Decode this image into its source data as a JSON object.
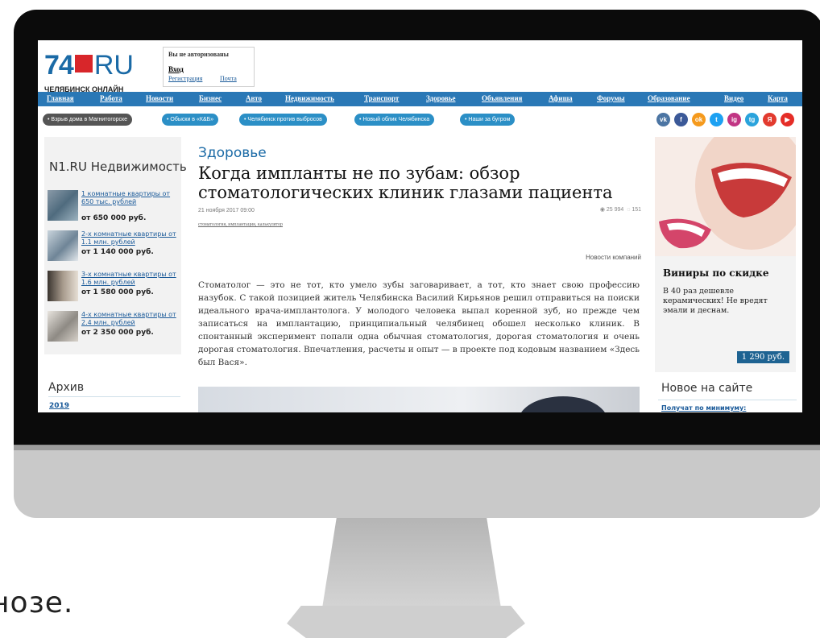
{
  "overlay": {
    "caption": "нозе."
  },
  "header": {
    "logo_number": "74",
    "logo_ru": "RU",
    "logo_sub": "ЧЕЛЯБИНСК ОНЛАЙН",
    "auth": {
      "title": "Вы не авторизованы",
      "login": "Вход",
      "register": "Регистрация",
      "mail": "Почта"
    }
  },
  "nav": [
    "Главная",
    "Работа",
    "Новости",
    "Бизнес",
    "Авто",
    "Недвижимость",
    "Транспорт",
    "Здоровье",
    "Объявления",
    "Афиша",
    "Форумы",
    "Образование",
    "Видео",
    "Карта"
  ],
  "tags": [
    "Взрыв дома в Магнитогорске",
    "Обыски в «К&Б»",
    "Челябинск против выбросов",
    "Новый облик Челябинска",
    "Наши за бугром"
  ],
  "social": [
    {
      "icon": "vk-icon",
      "label": "vk",
      "color": "#4c75a3"
    },
    {
      "icon": "facebook-icon",
      "label": "f",
      "color": "#3b5998"
    },
    {
      "icon": "odnoklassniki-icon",
      "label": "ok",
      "color": "#f59a1d"
    },
    {
      "icon": "twitter-icon",
      "label": "t",
      "color": "#1da1f2"
    },
    {
      "icon": "instagram-icon",
      "label": "ig",
      "color": "#c13584"
    },
    {
      "icon": "telegram-icon",
      "label": "tg",
      "color": "#2aa3dc"
    },
    {
      "icon": "yandex-icon",
      "label": "Я",
      "color": "#e23b2f"
    },
    {
      "icon": "youtube-icon",
      "label": "▶",
      "color": "#e52d27"
    }
  ],
  "left": {
    "n1_title": "N1.RU Недвижимость",
    "items": [
      {
        "link": "1 комнатные квартиры от 650 тыс. рублей",
        "price": "от 650 000 руб."
      },
      {
        "link": "2-х комнатные квартиры от 1.1 млн. рублей",
        "price": "от 1 140 000 руб."
      },
      {
        "link": "3-х комнатные квартиры от 1.6 млн. рублей",
        "price": "от 1 580 000 руб."
      },
      {
        "link": "4-х комнатные квартиры от 2.4 млн. рублей",
        "price": "от 2 350 000 руб."
      }
    ],
    "archive_title": "Архив",
    "archive_year": "2019"
  },
  "article": {
    "section": "Здоровье",
    "headline": "Когда импланты не по зубам: обзор стоматологических клиник глазами пациента",
    "date": "21 ноября 2017 09:00",
    "views": "25 994",
    "comments": "151",
    "tags": "стоматология, имплантация, калькулятор",
    "company_news": "Новости компаний",
    "lead": "Стоматолог — это не тот, кто умело зубы заговаривает, а тот, кто знает свою профессию назубок. С такой позицией житель Челябинска Василий Кирьянов решил отправиться на поиски идеального врача-имплантолога. У молодого человека выпал коренной зуб, но прежде чем записаться на имплантацию, принципиальный челябинец обошел несколько клиник. В спонтанный эксперимент попали одна обычная стоматология, дорогая стоматология и очень дорогая стоматология. Впечатления, расчеты и опыт — в проекте под кодовым названием «Здесь был Вася»."
  },
  "ad": {
    "title": "Виниры по скидке",
    "text": "В 40 раз дешевле керамических! Не вредят эмали и деснам.",
    "price": "1 290 руб."
  },
  "new_on_site": {
    "title": "Новое на сайте",
    "item": "Получат по минимуму:"
  }
}
